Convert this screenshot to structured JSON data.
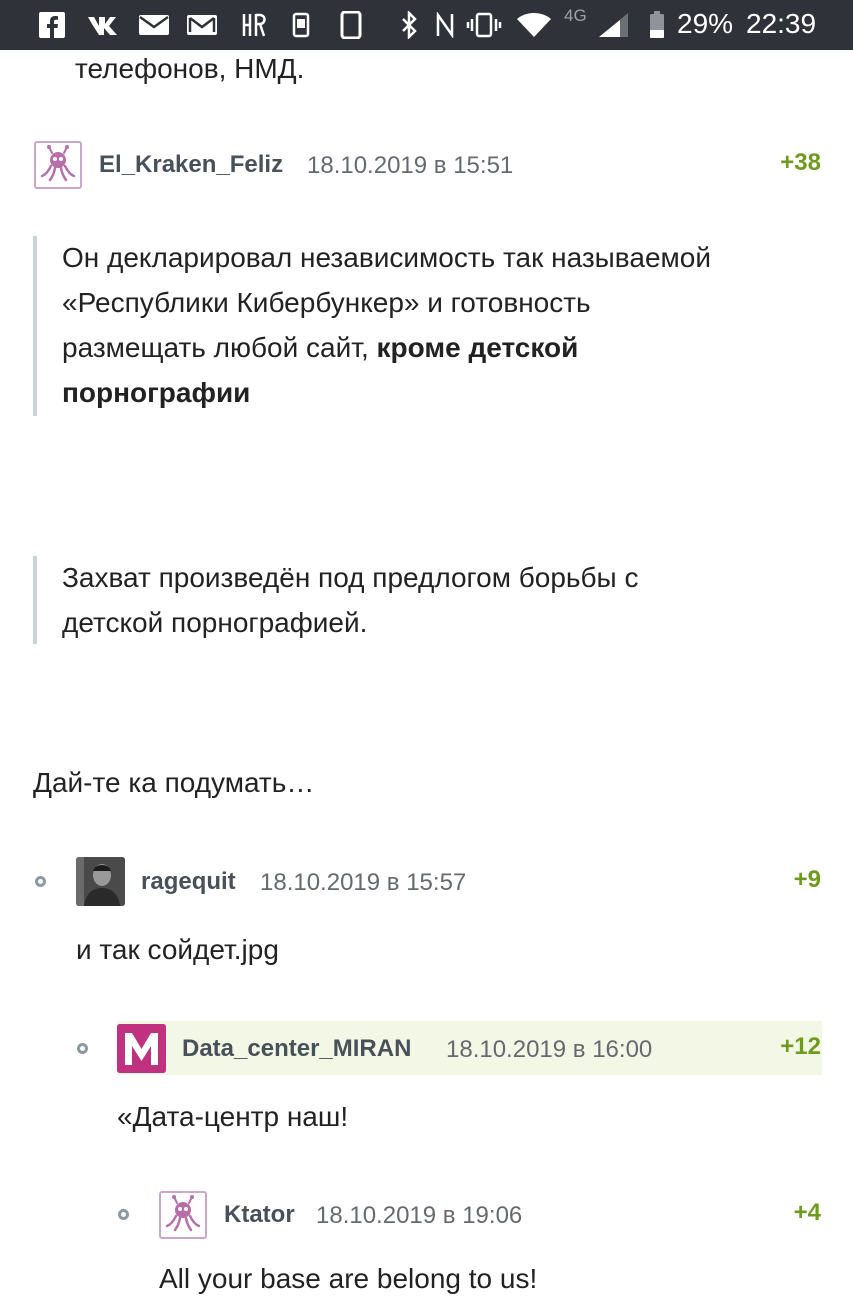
{
  "status_bar": {
    "battery": "29%",
    "time": "22:39",
    "network": "4G",
    "icons": [
      "facebook-icon",
      "vk-icon",
      "mail-icon",
      "gmail-icon",
      "hp-icon",
      "sim-icon",
      "phone-icon",
      "bluetooth-icon",
      "nfc-icon",
      "vibrate-icon",
      "wifi-icon",
      "signal-icon",
      "battery-icon"
    ]
  },
  "top_fragment": "телефонов, НМД.",
  "comments": [
    {
      "author": "El_Kraken_Feliz",
      "date": "18.10.2019 в 15:51",
      "score": "+38",
      "quote1_plain": "Он декларировал независимость так называемой «Республики Кибербункер» и готовность размещать любой сайт, ",
      "quote1_bold": "кроме детской порнографии",
      "quote2": "Захват произведён под предлогом борьбы с детской порнографией.",
      "text": "Дай-те ка подумать…"
    },
    {
      "author": "ragequit",
      "date": "18.10.2019 в 15:57",
      "score": "+9",
      "text": "и так сойдет.jpg"
    },
    {
      "author": "Data_center_MIRAN",
      "date": "18.10.2019 в 16:00",
      "score": "+12",
      "avatar_letter": "M",
      "text": "«Дата-центр наш!"
    },
    {
      "author": "Ktator",
      "date": "18.10.2019 в 19:06",
      "score": "+4",
      "text": "All your base are belong to us!"
    }
  ],
  "colors": {
    "status_bar": "#2f3238",
    "score_green": "#6e9a1e",
    "author": "#48515a",
    "quote_bar": "#c9d3da",
    "highlight": "#f3f8e6",
    "miran_brand": "#c0327f"
  }
}
